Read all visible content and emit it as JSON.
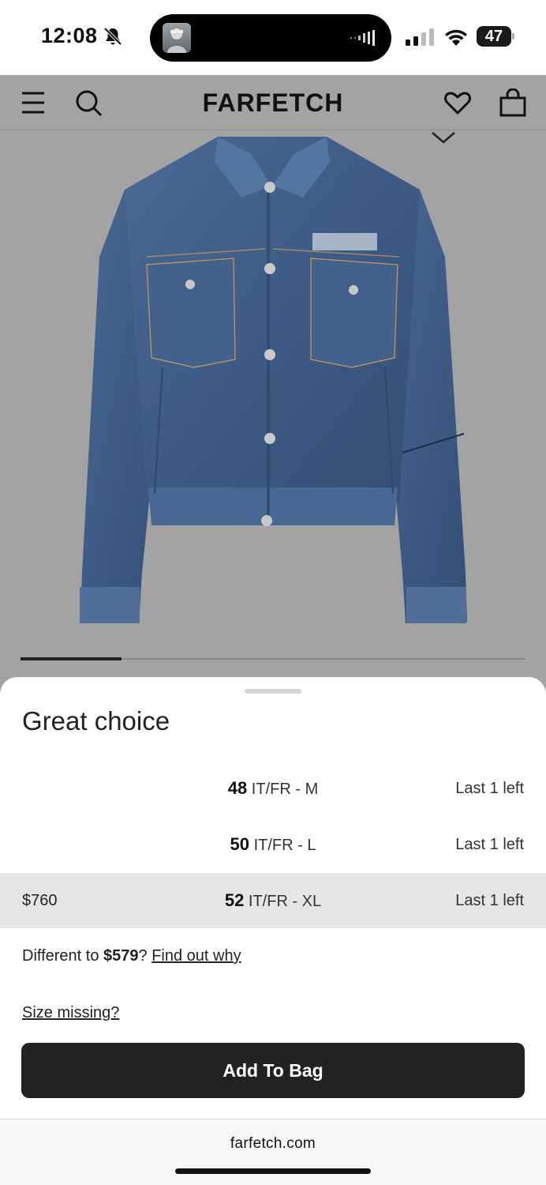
{
  "status_bar": {
    "time": "12:08",
    "battery": "47",
    "icons": [
      "bell-slash-icon",
      "signal-icon",
      "wifi-icon",
      "battery-icon"
    ]
  },
  "header": {
    "logo": "FARFETCH",
    "icons": [
      "menu-icon",
      "search-icon",
      "heart-icon",
      "bag-icon"
    ]
  },
  "gallery": {
    "image": "denim-jacket",
    "progress": 0.2
  },
  "sheet": {
    "title": "Great choice",
    "sizes": [
      {
        "price": "",
        "size": "48",
        "label": " IT/FR - M",
        "stock": "Last 1 left",
        "selected": false
      },
      {
        "price": "",
        "size": "50",
        "label": " IT/FR - L",
        "stock": "Last 1 left",
        "selected": false
      },
      {
        "price": "$760",
        "size": "52",
        "label": " IT/FR - XL",
        "stock": "Last 1 left",
        "selected": true
      }
    ],
    "diff_prefix": "Different to ",
    "diff_price": "$579",
    "diff_suffix": "? ",
    "find_out_why": "Find out why",
    "size_missing": "Size missing?",
    "add_to_bag": "Add To Bag"
  },
  "browser": {
    "url": "farfetch.com"
  },
  "colors": {
    "product_bg": "#a3a3a3",
    "button": "#222222",
    "selected_row": "#e6e6e6",
    "denim": "#3f5d86"
  }
}
